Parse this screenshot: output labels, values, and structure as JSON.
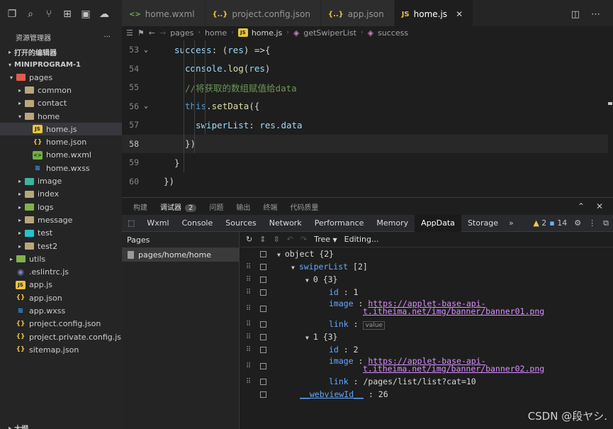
{
  "sidebar": {
    "title": "资源管理器",
    "more": "···",
    "open_editors": "打开的编辑器",
    "project": "MINIPROGRAM-1",
    "outline": "大纲",
    "tree": [
      {
        "label": "pages",
        "depth": 1,
        "expanded": "▾",
        "kind": "folder red"
      },
      {
        "label": "common",
        "depth": 2,
        "expanded": "▸",
        "kind": "folder"
      },
      {
        "label": "contact",
        "depth": 2,
        "expanded": "▸",
        "kind": "folder"
      },
      {
        "label": "home",
        "depth": 2,
        "expanded": "▾",
        "kind": "folder"
      },
      {
        "label": "home.js",
        "depth": 3,
        "expanded": "",
        "kind": "js",
        "selected": true
      },
      {
        "label": "home.json",
        "depth": 3,
        "expanded": "",
        "kind": "json"
      },
      {
        "label": "home.wxml",
        "depth": 3,
        "expanded": "",
        "kind": "wxml"
      },
      {
        "label": "home.wxss",
        "depth": 3,
        "expanded": "",
        "kind": "wxss"
      },
      {
        "label": "image",
        "depth": 2,
        "expanded": "▸",
        "kind": "folder teal"
      },
      {
        "label": "index",
        "depth": 2,
        "expanded": "▸",
        "kind": "folder"
      },
      {
        "label": "logs",
        "depth": 2,
        "expanded": "▸",
        "kind": "folder green"
      },
      {
        "label": "message",
        "depth": 2,
        "expanded": "▸",
        "kind": "folder"
      },
      {
        "label": "test",
        "depth": 2,
        "expanded": "▸",
        "kind": "folder cyan"
      },
      {
        "label": "test2",
        "depth": 2,
        "expanded": "▸",
        "kind": "folder"
      },
      {
        "label": "utils",
        "depth": 1,
        "expanded": "▸",
        "kind": "folder green"
      },
      {
        "label": ".eslintrc.js",
        "depth": 1,
        "expanded": "",
        "kind": "eslint"
      },
      {
        "label": "app.js",
        "depth": 1,
        "expanded": "",
        "kind": "js"
      },
      {
        "label": "app.json",
        "depth": 1,
        "expanded": "",
        "kind": "json"
      },
      {
        "label": "app.wxss",
        "depth": 1,
        "expanded": "",
        "kind": "wxss"
      },
      {
        "label": "project.config.json",
        "depth": 1,
        "expanded": "",
        "kind": "json"
      },
      {
        "label": "project.private.config.js...",
        "depth": 1,
        "expanded": "",
        "kind": "json"
      },
      {
        "label": "sitemap.json",
        "depth": 1,
        "expanded": "",
        "kind": "json"
      }
    ]
  },
  "tabs": [
    {
      "label": "home.wxml",
      "icon": "wxml",
      "active": false
    },
    {
      "label": "project.config.json",
      "icon": "json",
      "active": false
    },
    {
      "label": "app.json",
      "icon": "json",
      "active": false
    },
    {
      "label": "home.js",
      "icon": "js",
      "active": true
    }
  ],
  "breadcrumb": [
    "pages",
    "home",
    "home.js",
    "getSwiperList",
    "success"
  ],
  "editor": {
    "lines": [
      {
        "num": "53",
        "fold": "⌄",
        "indent": 2,
        "html": "<span class='k-prop'>success</span>: (<span class='k-prop'>res</span>) =&gt;{"
      },
      {
        "num": "54",
        "fold": "",
        "indent": 3,
        "html": "<span class='k-prop'>console</span>.<span class='k-fn'>log</span>(<span class='k-prop'>res</span>)"
      },
      {
        "num": "55",
        "fold": "",
        "indent": 3,
        "html": "<span class='k-cmt'>//将获取的数组赋值给data</span>"
      },
      {
        "num": "56",
        "fold": "⌄",
        "indent": 3,
        "html": "<span class='k-kw'>this</span>.<span class='k-fn'>setData</span>({"
      },
      {
        "num": "57",
        "fold": "",
        "indent": 4,
        "html": "<span class='k-prop'>swiperList</span>: <span class='k-prop'>res</span>.<span class='k-prop'>data</span>"
      },
      {
        "num": "58",
        "fold": "",
        "indent": 3,
        "html": "})",
        "current": true
      },
      {
        "num": "59",
        "fold": "",
        "indent": 2,
        "html": "}"
      },
      {
        "num": "60",
        "fold": "",
        "indent": 1,
        "html": "})"
      }
    ]
  },
  "panel": {
    "tabs": [
      "构建",
      "调试器",
      "问题",
      "输出",
      "终端",
      "代码质量"
    ],
    "debugger_badge": "2",
    "active_tab": "调试器"
  },
  "devtools": {
    "tabs": [
      "Wxml",
      "Console",
      "Sources",
      "Network",
      "Performance",
      "Memory",
      "AppData",
      "Storage"
    ],
    "active": "AppData",
    "more": "»",
    "warnings": "2",
    "messages": "14",
    "pages_title": "Pages",
    "page_item": "pages/home/home",
    "toolbar": {
      "mode": "Tree",
      "editing": "Editing..."
    }
  },
  "appdata": {
    "object": "object",
    "object_count": "{2}",
    "swiperList": "swiperList",
    "swiperList_count": "[2]",
    "items": [
      {
        "index": "0",
        "count": "{3}",
        "id": "1",
        "image_1": "https://applet-base-api-",
        "image_2": "t.itheima.net/img/banner/banner01.png",
        "link": "value"
      },
      {
        "index": "1",
        "count": "{3}",
        "id": "2",
        "image_1": "https://applet-base-api-",
        "image_2": "t.itheima.net/img/banner/banner02.png",
        "link": "/pages/list/list?cat=10"
      }
    ],
    "webviewId_key": "__webviewId__",
    "webviewId": "26"
  },
  "watermark": "CSDN @段ヤシ."
}
